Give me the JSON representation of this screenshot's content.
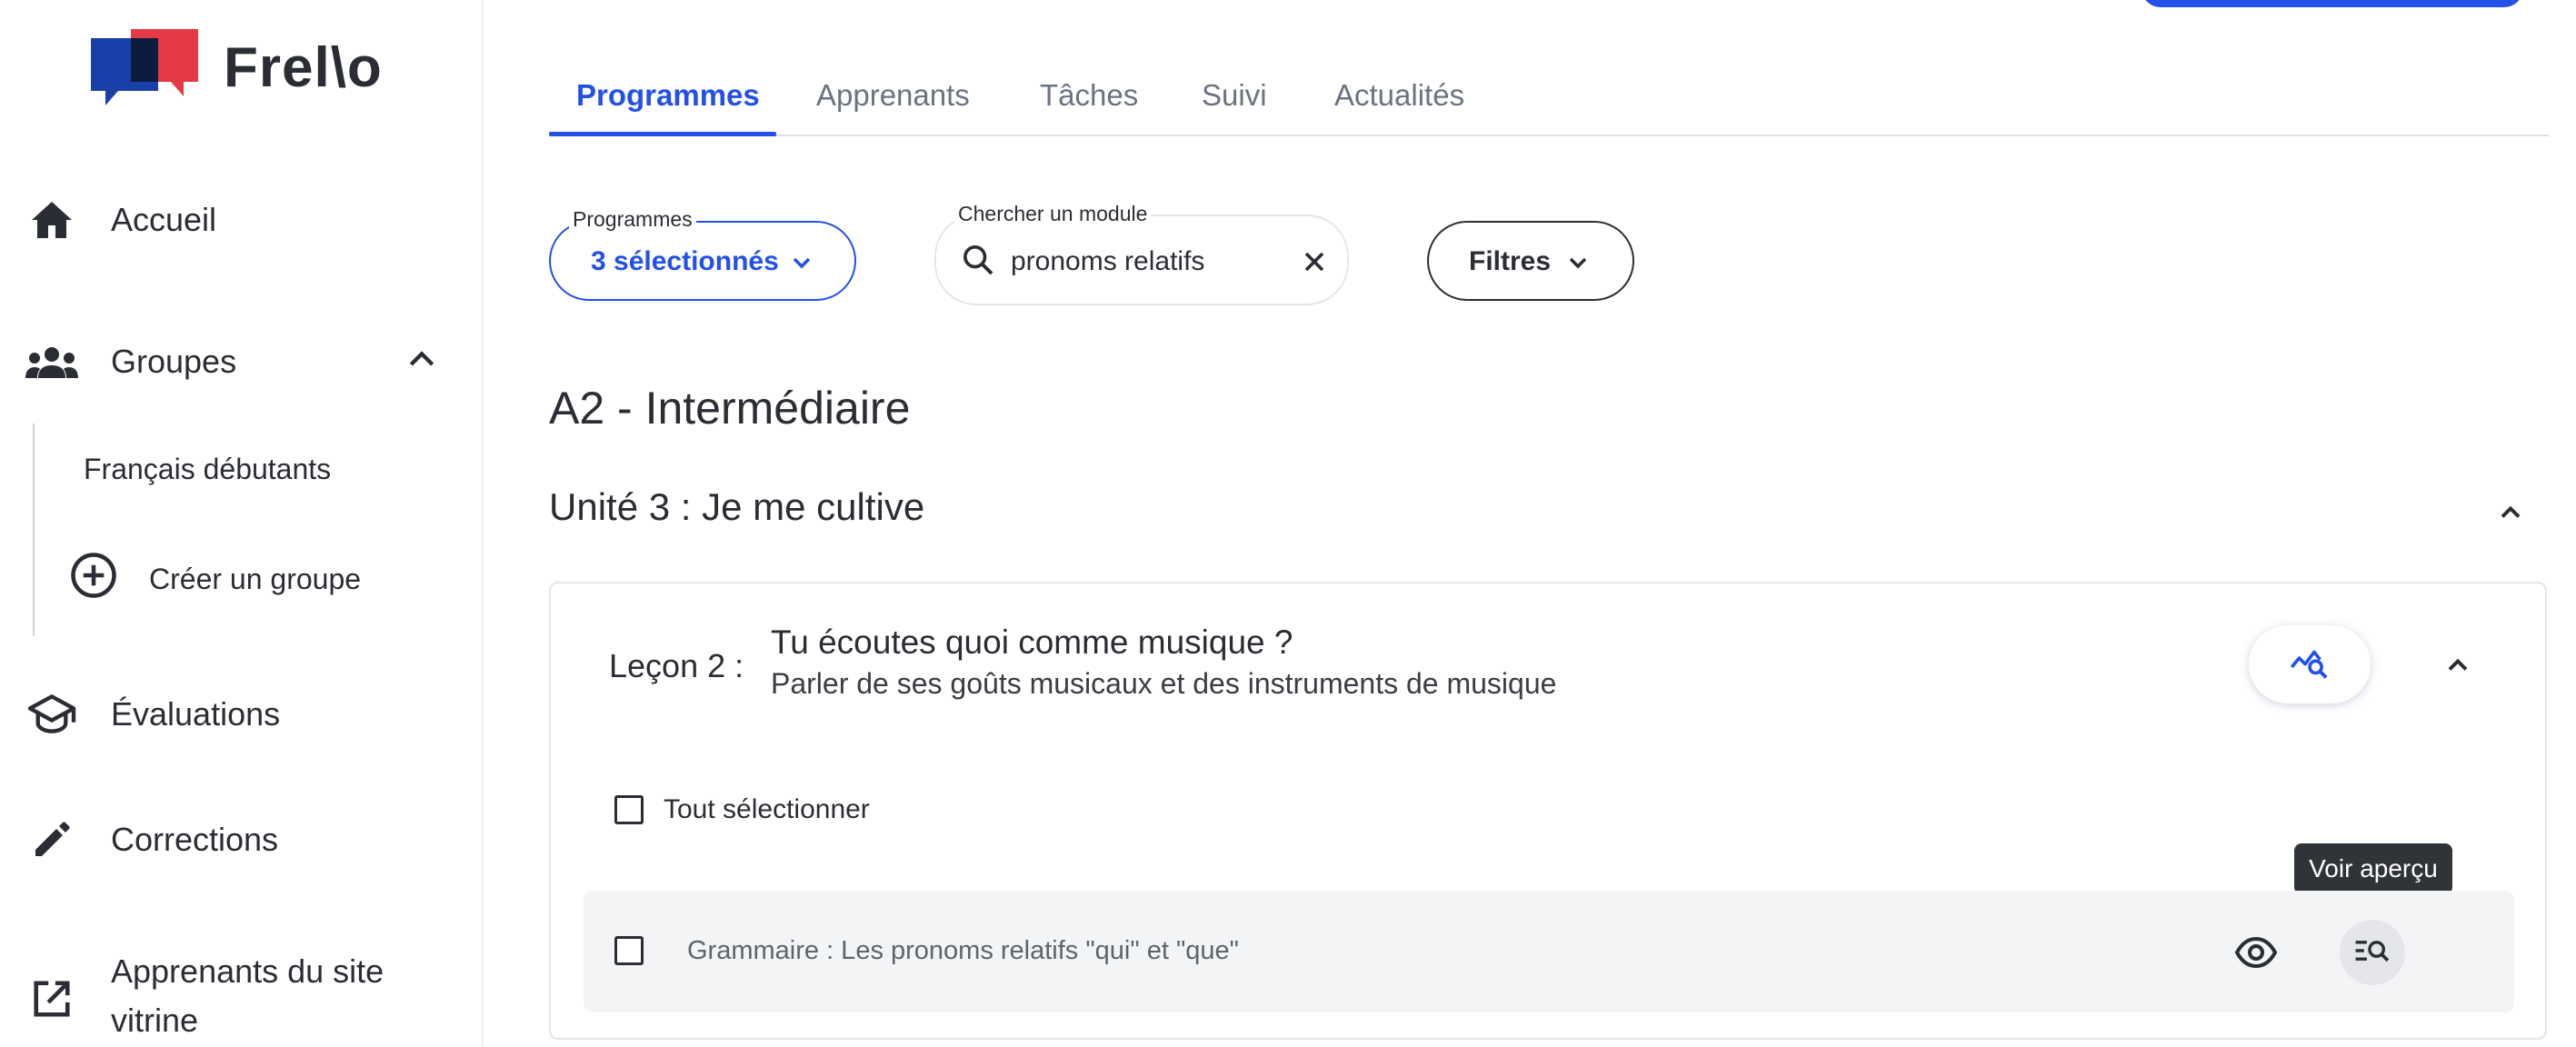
{
  "app": {
    "name": "Frel\\o"
  },
  "sidebar": {
    "items": [
      {
        "label": "Accueil",
        "icon": "home-icon"
      },
      {
        "label": "Groupes",
        "icon": "groups-icon",
        "expanded": true
      },
      {
        "label": "Évaluations",
        "icon": "graduation-cap-icon"
      },
      {
        "label": "Corrections",
        "icon": "pencil-icon"
      },
      {
        "label": "Apprenants du site vitrine",
        "icon": "external-link-icon"
      }
    ],
    "groups": {
      "items": [
        "Français débutants"
      ],
      "create_label": "Créer un groupe"
    }
  },
  "tabs": [
    {
      "label": "Programmes",
      "active": true
    },
    {
      "label": "Apprenants"
    },
    {
      "label": "Tâches"
    },
    {
      "label": "Suivi"
    },
    {
      "label": "Actualités"
    }
  ],
  "filters": {
    "programmes": {
      "legend": "Programmes",
      "value": "3 sélectionnés"
    },
    "search": {
      "legend": "Chercher un module",
      "value": "pronoms relatifs"
    },
    "filters_label": "Filtres"
  },
  "content": {
    "level": "A2 - Intermédiaire",
    "unit": "Unité 3 : Je me cultive",
    "lesson": {
      "number": "Leçon 2 :",
      "title": "Tu écoutes quoi comme musique ?",
      "subtitle": "Parler de ses goûts musicaux et des instruments de musique",
      "select_all": "Tout sélectionner",
      "modules": [
        {
          "label": "Grammaire : Les pronoms relatifs \"qui\" et \"que\""
        }
      ],
      "tooltip": "Voir aperçu"
    }
  },
  "colors": {
    "accent": "#2350e6",
    "logo_blue": "#1a3fa8",
    "logo_red": "#e63946",
    "text": "#2a2d34"
  }
}
